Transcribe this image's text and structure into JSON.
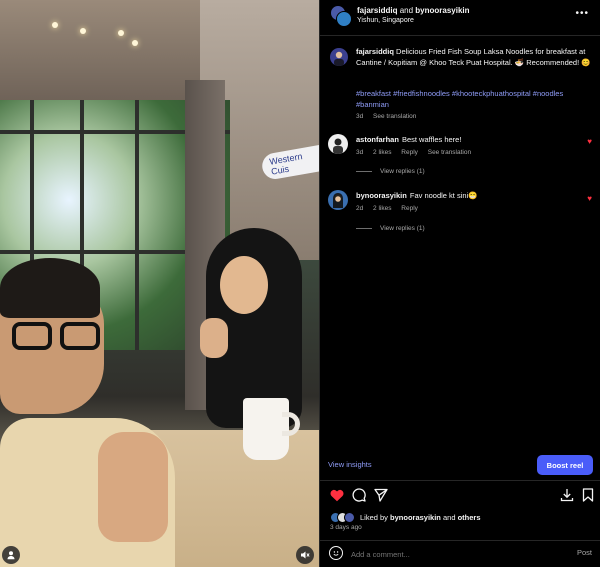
{
  "post": {
    "author": "fajarsiddiq",
    "and_text": "and",
    "collaborator": "bynoorasyikin",
    "location": "Yishun, Singapore",
    "more_icon": "more-horizontal-icon",
    "caption_author": "fajarsiddiq",
    "caption_text": "Delicious Fried Fish Soup Laksa Noodles for breakfast at Cantine / Kopitiam @ Khoo Teck Puat Hospital. 🍜 Recommended! 😊",
    "hashtags": "#breakfast #friedfishnoodles #khooteckphuathospital #noodles #banmian",
    "caption_age": "3d",
    "see_translation": "See translation"
  },
  "photo": {
    "sign_text": "Western Cuis",
    "user_icon": "user-icon",
    "mute_icon": "muted-icon"
  },
  "comments": [
    {
      "username": "astonfarhan",
      "text": "Best waffles here!",
      "age": "3d",
      "likes": "2 likes",
      "reply": "Reply",
      "see_translation": "See translation",
      "view_replies": "View replies (1)",
      "liked": true
    },
    {
      "username": "bynoorasyikin",
      "text": "Fav noodle kt sini😁",
      "age": "2d",
      "likes": "2 likes",
      "reply": "Reply",
      "view_replies": "View replies (1)",
      "liked": true
    }
  ],
  "insights": {
    "view_insights": "View insights",
    "boost_label": "Boost reel"
  },
  "actions": {
    "like_icon": "heart-filled-icon",
    "comment_icon": "comment-icon",
    "share_icon": "share-icon",
    "download_icon": "download-icon",
    "save_icon": "bookmark-icon"
  },
  "likes": {
    "prefix": "Liked by",
    "user": "bynoorasyikin",
    "and_text": "and",
    "others": "others"
  },
  "date": "3 days ago",
  "comment_box": {
    "placeholder": "Add a comment...",
    "post_label": "Post",
    "emoji_icon": "emoji-icon"
  },
  "colors": {
    "background": "#000000",
    "link_blue": "#8f9cf7",
    "boost_blue": "#4a5df9",
    "heart_red": "#ff3040",
    "secondary_text": "#a8a8a8"
  }
}
